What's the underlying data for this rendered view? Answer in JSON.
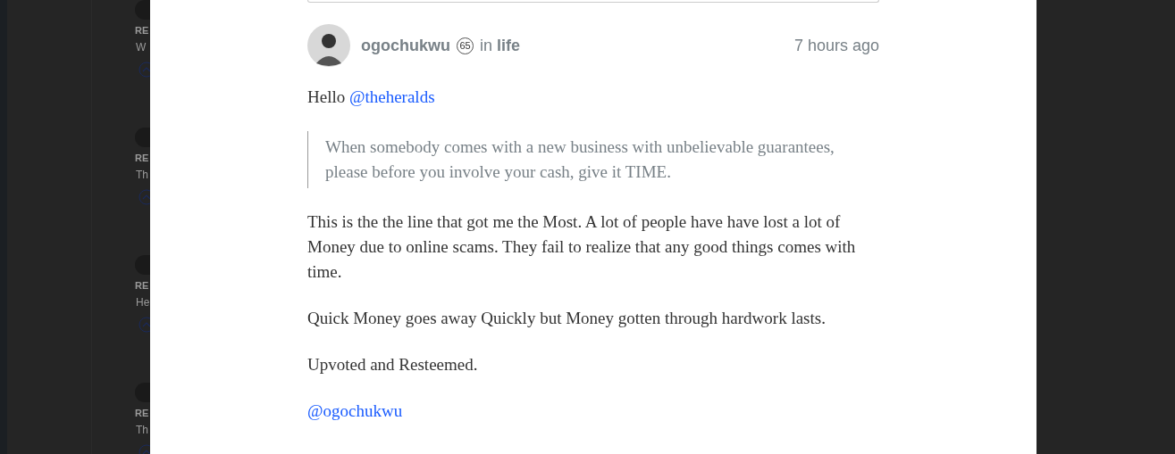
{
  "background_comments": [
    {
      "title": "RE",
      "text": "W"
    },
    {
      "title": "RE",
      "text": "Th"
    },
    {
      "title": "RE",
      "text": "He"
    },
    {
      "title": "RE",
      "text": "Th"
    }
  ],
  "comment": {
    "author": "ogochukwu",
    "reputation": "65",
    "in_label": "in",
    "category": "life",
    "time": "7 hours ago",
    "body": [
      {
        "kind": "paragraph",
        "text": "Hello",
        "link": "@theheralds"
      },
      {
        "kind": "quote",
        "text": "When somebody comes with a new business with unbelievable guarantees, please before you involve your cash, give it TIME."
      },
      {
        "kind": "paragraph",
        "text": "This is the the line that got me the Most. A lot of people have have lost a lot of Money due to online scams. They fail to realize that any good things comes with time."
      },
      {
        "kind": "paragraph",
        "text": "Quick Money goes away Quickly but Money gotten through hardwork lasts."
      },
      {
        "kind": "paragraph",
        "text": "Upvoted and Resteemed."
      },
      {
        "kind": "link",
        "text": "@ogochukwu"
      }
    ]
  }
}
